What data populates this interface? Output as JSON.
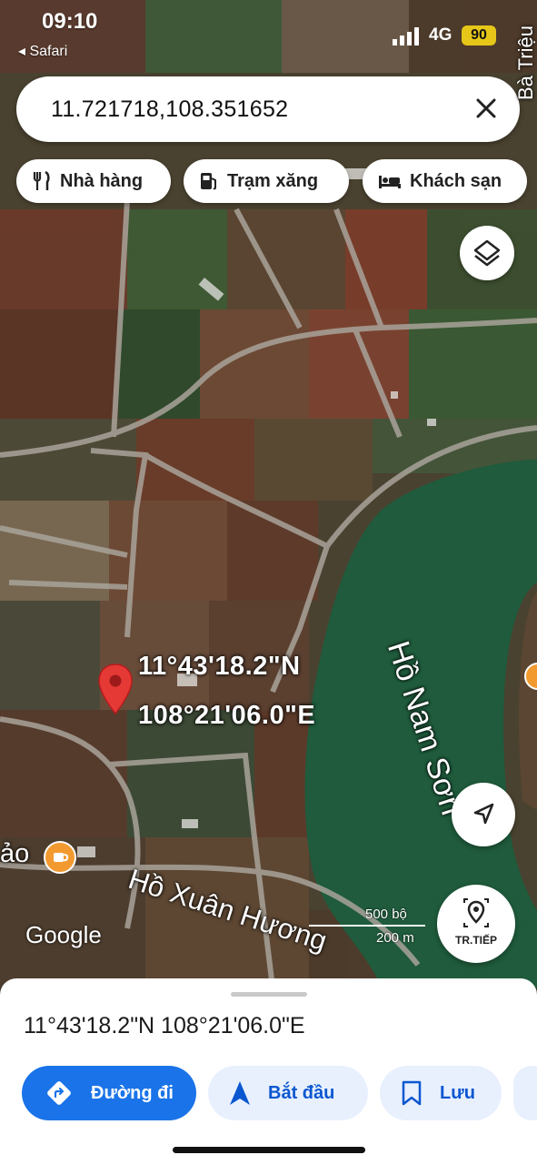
{
  "status_bar": {
    "time": "09:10",
    "back_label": "◂ Safari",
    "network": "4G",
    "battery": "90"
  },
  "search": {
    "value": "11.721718,108.351652"
  },
  "chips": [
    {
      "label": "Nhà hàng",
      "icon": "restaurant-icon"
    },
    {
      "label": "Trạm xăng",
      "icon": "gas-station-icon"
    },
    {
      "label": "Khách sạn",
      "icon": "hotel-icon"
    }
  ],
  "map": {
    "pin_lat": "11°43'18.2\"N",
    "pin_lng": "108°21'06.0\"E",
    "lake_label": "Hồ Nam Sơn",
    "road_label": "Hồ Xuân Hương",
    "place_partial": "ảo",
    "edge_label": "Bà Triệu",
    "attribution": "Google",
    "scale_ft": "500 bộ",
    "scale_m": "200 m",
    "continue_label": "TR.TIẾP"
  },
  "sheet": {
    "coordinates": "11°43'18.2\"N 108°21'06.0\"E",
    "actions": [
      {
        "label": "Đường đi",
        "icon": "directions-icon",
        "primary": true
      },
      {
        "label": "Bắt đầu",
        "icon": "navigate-arrow-icon",
        "primary": false
      },
      {
        "label": "Lưu",
        "icon": "bookmark-icon",
        "primary": false
      }
    ]
  },
  "colors": {
    "accent": "#1a73e8",
    "pin": "#e53935",
    "lake": "#1f5b3c",
    "battery": "#e6c618"
  }
}
